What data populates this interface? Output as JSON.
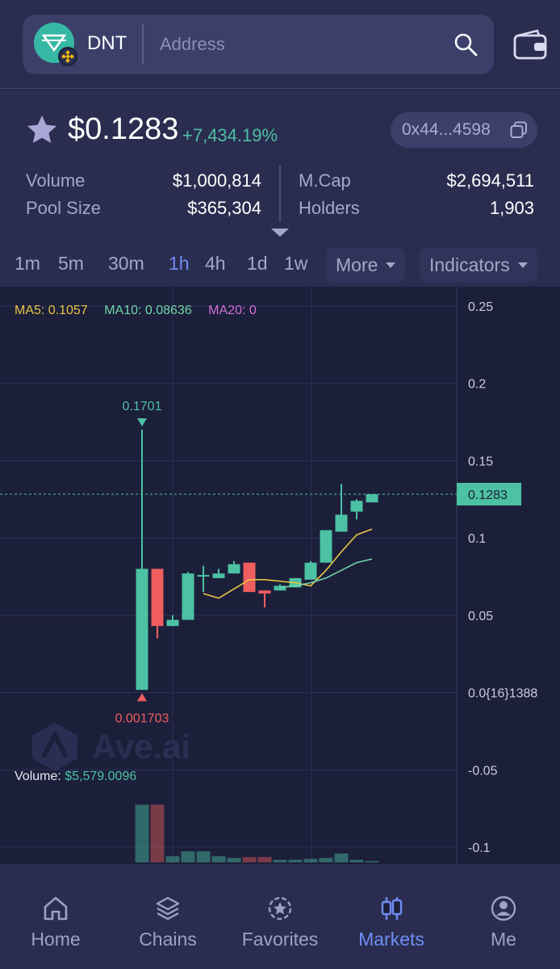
{
  "header": {
    "token_symbol": "DNT",
    "search_placeholder": "Address",
    "icons": [
      "token-logo",
      "bnb-chain-badge",
      "search-icon",
      "wallet-icon"
    ]
  },
  "token": {
    "price": "$0.1283",
    "change": "+7,434.19%",
    "address": "0x44...4598",
    "stats": {
      "volume_label": "Volume",
      "volume": "$1,000,814",
      "pool_label": "Pool Size",
      "pool": "$365,304",
      "mcap_label": "M.Cap",
      "mcap": "$2,694,511",
      "holders_label": "Holders",
      "holders": "1,903"
    }
  },
  "timeframes": [
    "1m",
    "5m",
    "30m",
    "1h",
    "4h",
    "1d",
    "1w"
  ],
  "active_timeframe": "1h",
  "more_label": "More",
  "indicators_label": "Indicators",
  "colors": {
    "up": "#4cc1a3",
    "down": "#ee5e5e",
    "accent": "#6f8df5",
    "ma5": "#e8c547",
    "ma10": "#6ed6a8",
    "ma20": "#d16fd9"
  },
  "chart_data": {
    "type": "candlestick",
    "ma_legend": {
      "ma5": "MA5: 0.1057",
      "ma10": "MA10: 0.08636",
      "ma20": "MA20: 0"
    },
    "y_ticks": [
      "0.25",
      "0.2",
      "0.15",
      "0.1",
      "0.05",
      "0.0{16}1388",
      "-0.05",
      "-0.1"
    ],
    "ylim": [
      -0.1,
      0.25
    ],
    "last_price": "0.1283",
    "high_label": "0.1701",
    "low_label": "0.001703",
    "volume_label": "Volume: ",
    "volume_value": "$5,579.0096",
    "candles": [
      {
        "o": 0.0017,
        "h": 0.1701,
        "l": 0.0017,
        "c": 0.08
      },
      {
        "o": 0.08,
        "h": 0.08,
        "l": 0.035,
        "c": 0.043
      },
      {
        "o": 0.043,
        "h": 0.05,
        "l": 0.043,
        "c": 0.047
      },
      {
        "o": 0.047,
        "h": 0.078,
        "l": 0.047,
        "c": 0.077
      },
      {
        "o": 0.075,
        "h": 0.082,
        "l": 0.065,
        "c": 0.076
      },
      {
        "o": 0.074,
        "h": 0.08,
        "l": 0.074,
        "c": 0.077
      },
      {
        "o": 0.077,
        "h": 0.085,
        "l": 0.077,
        "c": 0.083
      },
      {
        "o": 0.084,
        "h": 0.084,
        "l": 0.065,
        "c": 0.065
      },
      {
        "o": 0.066,
        "h": 0.066,
        "l": 0.055,
        "c": 0.064
      },
      {
        "o": 0.066,
        "h": 0.07,
        "l": 0.066,
        "c": 0.069
      },
      {
        "o": 0.068,
        "h": 0.074,
        "l": 0.068,
        "c": 0.074
      },
      {
        "o": 0.073,
        "h": 0.085,
        "l": 0.073,
        "c": 0.084
      },
      {
        "o": 0.084,
        "h": 0.105,
        "l": 0.084,
        "c": 0.105
      },
      {
        "o": 0.104,
        "h": 0.135,
        "l": 0.104,
        "c": 0.115
      },
      {
        "o": 0.117,
        "h": 0.125,
        "l": 0.112,
        "c": 0.124
      },
      {
        "o": 0.123,
        "h": 0.1283,
        "l": 0.123,
        "c": 0.1283
      }
    ],
    "volumes": [
      130,
      130,
      14,
      25,
      25,
      14,
      10,
      12,
      12,
      6,
      6,
      8,
      10,
      20,
      6,
      3
    ],
    "ma5": [
      null,
      null,
      null,
      null,
      0.064,
      0.061,
      0.067,
      0.073,
      0.073,
      0.072,
      0.071,
      0.069,
      0.079,
      0.091,
      0.102,
      0.1057
    ],
    "ma10": [
      null,
      null,
      null,
      null,
      null,
      null,
      null,
      null,
      null,
      0.068,
      0.069,
      0.071,
      0.074,
      0.079,
      0.084,
      0.08636
    ],
    "grid": true
  },
  "nav": [
    {
      "label": "Home",
      "icon": "home-icon"
    },
    {
      "label": "Chains",
      "icon": "layers-icon"
    },
    {
      "label": "Favorites",
      "icon": "star-badge-icon"
    },
    {
      "label": "Markets",
      "icon": "candles-icon"
    },
    {
      "label": "Me",
      "icon": "profile-icon"
    }
  ],
  "active_nav": "Markets"
}
